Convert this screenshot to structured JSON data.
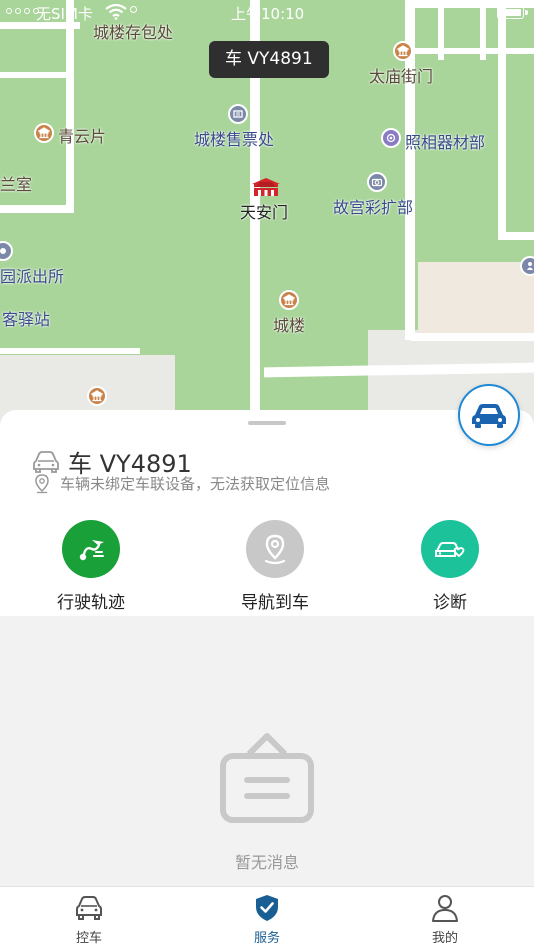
{
  "status_bar": {
    "carrier": "无SIM卡",
    "time": "上午10:10"
  },
  "map": {
    "tooltip": "车 VY4891",
    "pois": {
      "chenglou_cunbao": "城楼存包处",
      "taimiao_jiemen": "太庙街门",
      "qingyunpian": "青云片",
      "chenglou_shoupiao": "城楼售票处",
      "zhaoxiang": "照相器材部",
      "lanshi": "兰室",
      "tiananmen": "天安门",
      "gugong_caikuo": "故宫彩扩部",
      "paichusuo": "园派出所",
      "yizhan": "客驿站",
      "chenglou": "城楼"
    }
  },
  "vehicle": {
    "plate": "车 VY4891",
    "location_notice": "车辆未绑定车联设备，无法获取定位信息"
  },
  "actions": [
    {
      "label": "行驶轨迹",
      "icon": "route-icon",
      "color": "#1aa039"
    },
    {
      "label": "导航到车",
      "icon": "location-pin-icon",
      "color": "#c8c8c8"
    },
    {
      "label": "诊断",
      "icon": "car-diagnosis-icon",
      "color": "#1cc39a"
    }
  ],
  "empty_state": {
    "message": "暂无消息"
  },
  "tabs": [
    {
      "label": "控车",
      "icon": "car-icon",
      "active": false
    },
    {
      "label": "服务",
      "icon": "shield-check-icon",
      "active": true
    },
    {
      "label": "我的",
      "icon": "user-icon",
      "active": false
    }
  ],
  "colors": {
    "map_green": "#a9d59a",
    "accent_blue": "#1e8ad6",
    "active_tab": "#1a5f93"
  }
}
